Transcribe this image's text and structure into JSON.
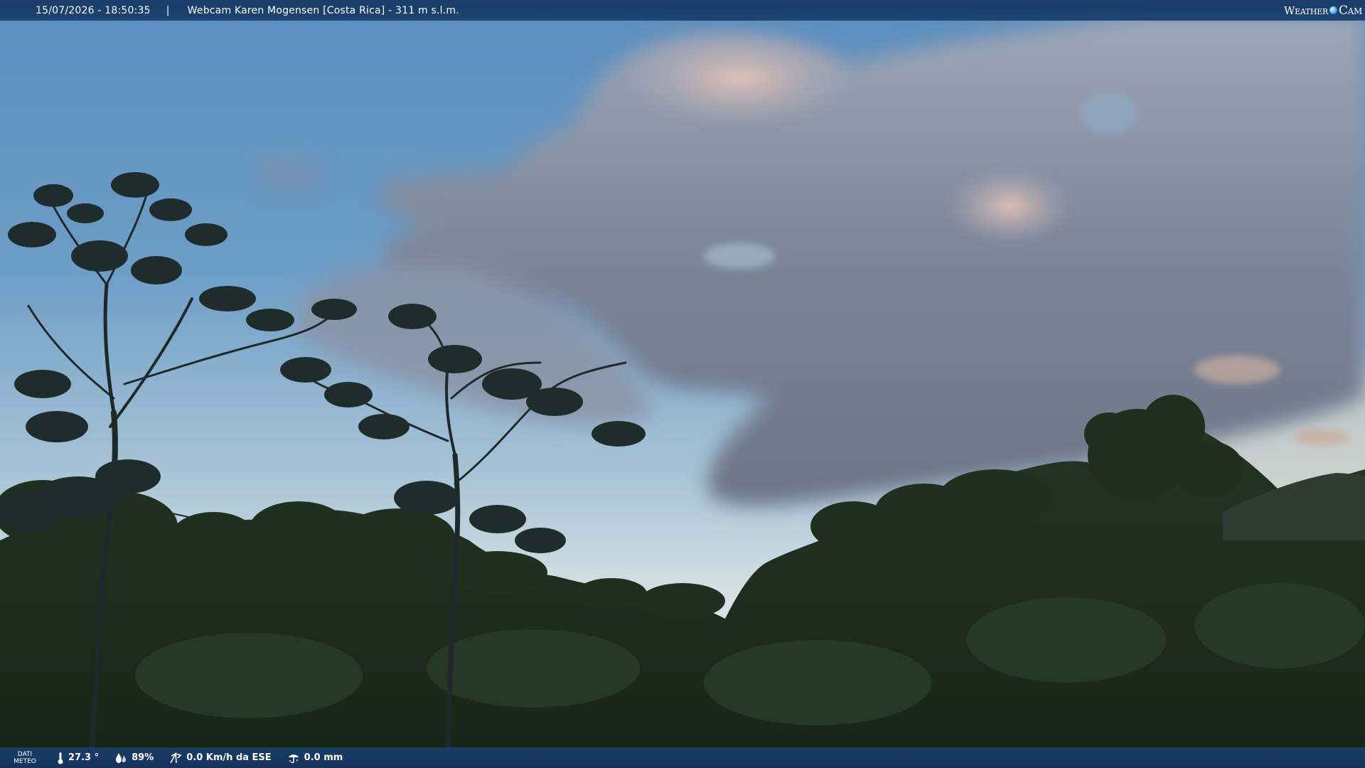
{
  "header": {
    "datetime": "15/07/2026 - 18:50:35",
    "separator": "|",
    "location": "Webcam Karen Mogensen [Costa Rica] - 311 m s.l.m."
  },
  "brand": {
    "part1": "Weather",
    "part2": "Cam",
    "icon": "globe-icon"
  },
  "weather": {
    "label_line1": "DATI",
    "label_line2": "METEO",
    "temperature": "27.3 °",
    "humidity": "89%",
    "wind": "0.0 Km/h da ESE",
    "rain": "0.0 mm",
    "icons": [
      "thermometer-icon",
      "humidity-icon",
      "wind-icon",
      "rain-icon"
    ]
  },
  "colors": {
    "bar": "#183e6c",
    "sky_top": "#5f8fbe",
    "sky_horizon": "#d7e3e6",
    "foliage": "#1e2f1f"
  }
}
